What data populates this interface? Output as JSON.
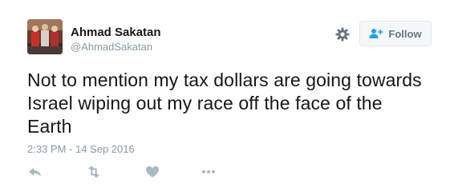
{
  "author": {
    "display_name": "Ahmad Sakatan",
    "screen_name": "@AhmadSakatan",
    "avatar_icon": "profile-photo"
  },
  "header": {
    "settings_icon": "gear-icon",
    "follow_button": {
      "label": "Follow",
      "icon": "add-user-icon",
      "accent_color": "#1da1f2"
    }
  },
  "tweet": {
    "text": "Not to mention my tax dollars are going towards Israel wiping out my race off the face of the Earth",
    "timestamp": "2:33 PM - 14 Sep 2016"
  },
  "actions": [
    {
      "name": "reply",
      "icon": "reply-icon"
    },
    {
      "name": "retweet",
      "icon": "retweet-icon"
    },
    {
      "name": "like",
      "icon": "heart-icon"
    },
    {
      "name": "more",
      "icon": "more-icon"
    }
  ],
  "colors": {
    "text_primary": "#14171a",
    "text_secondary": "#8899a6",
    "icon_gray": "#aab8c2"
  }
}
